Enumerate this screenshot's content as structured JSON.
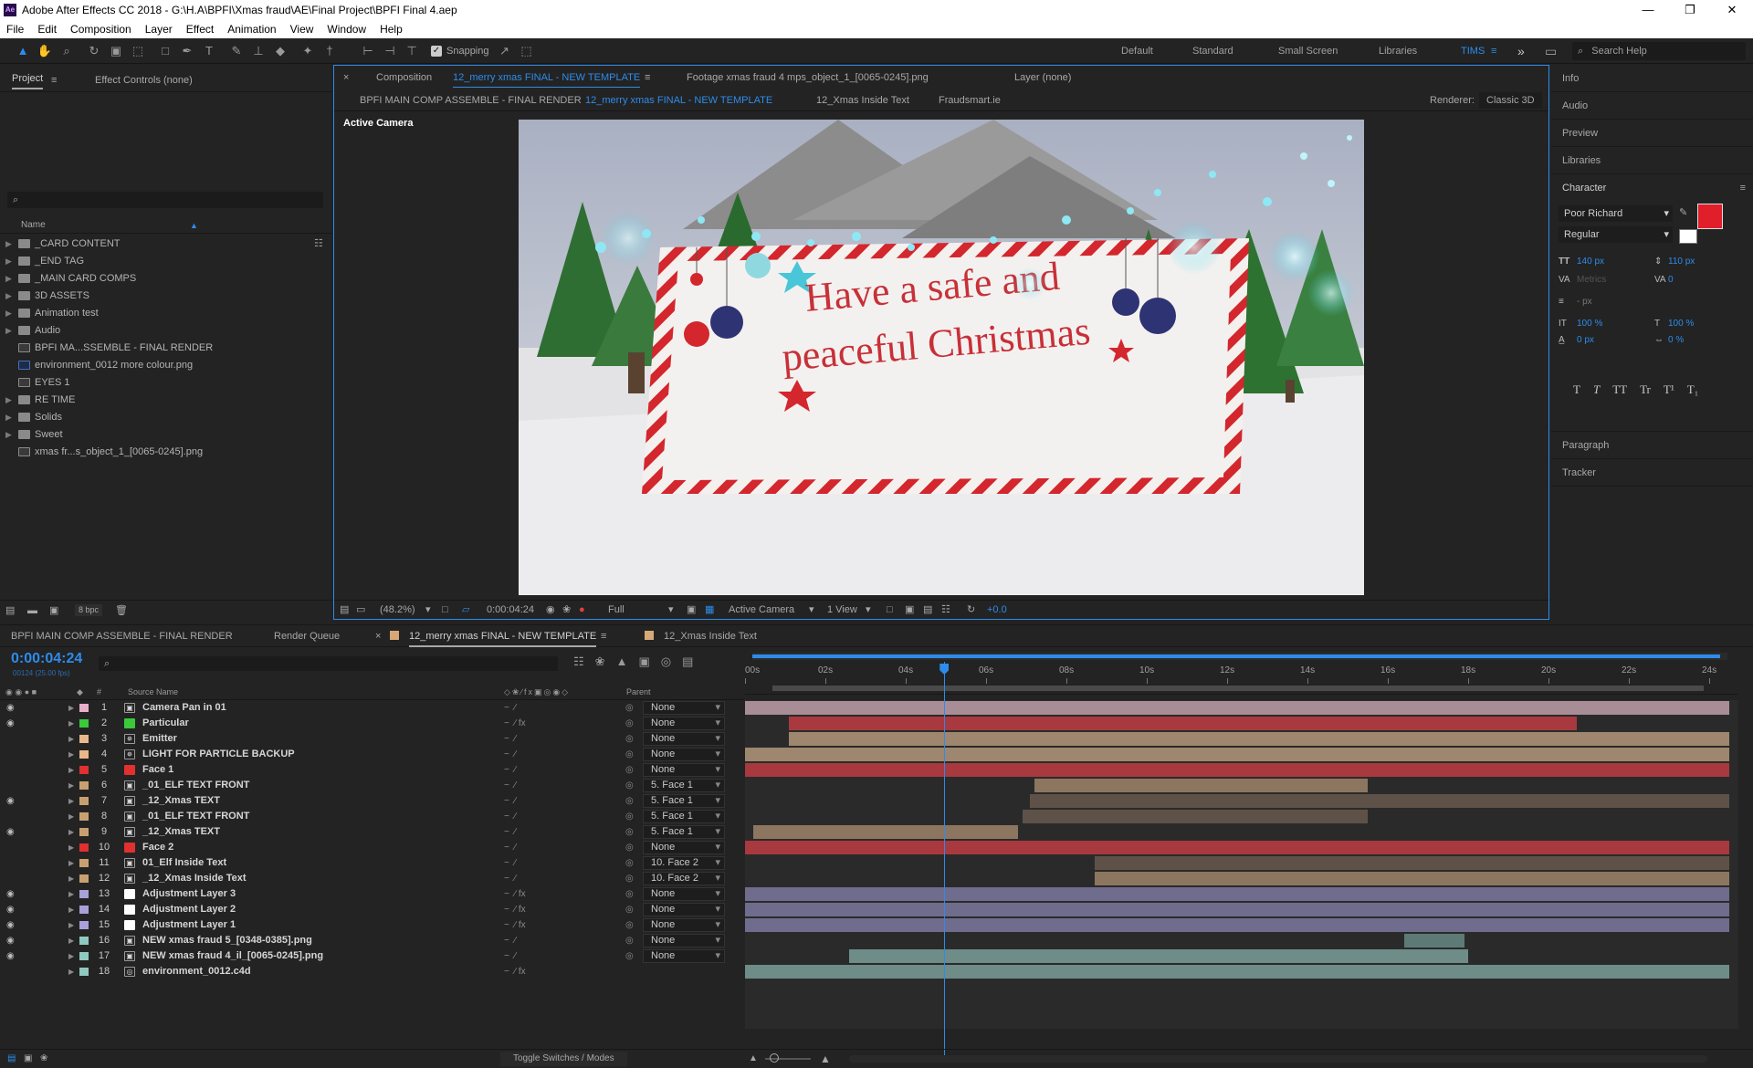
{
  "app": {
    "title": "Adobe After Effects CC 2018 - G:\\H.A\\BPFI\\Xmas fraud\\AE\\Final Project\\BPFI Final 4.aep",
    "logo": "Ae",
    "win": {
      "min": "—",
      "max": "❐",
      "close": "✕"
    }
  },
  "menu": [
    "File",
    "Edit",
    "Composition",
    "Layer",
    "Effect",
    "Animation",
    "View",
    "Window",
    "Help"
  ],
  "toolbar": {
    "snapping": "Snapping",
    "workspaces": [
      "Default",
      "Standard",
      "Small Screen",
      "Libraries",
      "TIMS"
    ],
    "active_workspace": "TIMS",
    "more": "»",
    "search": "Search Help"
  },
  "project": {
    "tab": "Project",
    "menu": "≡",
    "effects_tab": "Effect Controls (none)",
    "search_placeholder": "",
    "col_name": "Name",
    "bpc": "8 bpc",
    "items": [
      {
        "name": "_CARD CONTENT",
        "type": "folder"
      },
      {
        "name": "_END TAG",
        "type": "folder"
      },
      {
        "name": "_MAIN CARD COMPS",
        "type": "folder"
      },
      {
        "name": "3D ASSETS",
        "type": "folder"
      },
      {
        "name": "Animation test",
        "type": "folder"
      },
      {
        "name": "Audio",
        "type": "folder"
      },
      {
        "name": "BPFI MA...SSEMBLE - FINAL RENDER",
        "type": "comp"
      },
      {
        "name": "environment_0012 more colour.png",
        "type": "ps"
      },
      {
        "name": "EYES 1",
        "type": "comp"
      },
      {
        "name": "RE TIME",
        "type": "folder"
      },
      {
        "name": "Solids",
        "type": "folder"
      },
      {
        "name": "Sweet",
        "type": "folder"
      },
      {
        "name": "xmas fr...s_object_1_[0065-0245].png",
        "type": "footage"
      }
    ]
  },
  "viewer": {
    "comp_tab_prefix": "Composition",
    "comp_tab_name": "12_merry xmas FINAL - NEW TEMPLATE",
    "menu": "≡",
    "footage_tab": "Footage xmas fraud 4 mps_object_1_[0065-0245].png",
    "layer_tab": "Layer (none)",
    "breadcrumbs": [
      "BPFI MAIN COMP ASSEMBLE - FINAL RENDER",
      "12_merry xmas FINAL - NEW TEMPLATE",
      "12_Xmas Inside Text",
      "Fraudsmart.ie"
    ],
    "renderer_label": "Renderer:",
    "renderer": "Classic 3D",
    "active_camera": "Active Camera",
    "card_line1": "Have a safe and",
    "card_line2": "peaceful Christmas",
    "footer": {
      "zoom": "(48.2%)",
      "time": "0:00:04:24",
      "resolution": "Full",
      "camera": "Active Camera",
      "views": "1 View",
      "exposure": "+0.0"
    }
  },
  "right": {
    "items": [
      "Info",
      "Audio",
      "Preview",
      "Libraries"
    ],
    "character": "Character",
    "menu": "≡",
    "font": "Poor Richard",
    "style": "Regular",
    "size": "140 px",
    "leading": "110 px",
    "kerning": "Metrics",
    "tracking": "0",
    "stroke": "- px",
    "vscale": "100 %",
    "hscale": "100 %",
    "baseline": "0 px",
    "tsume": "0 %",
    "style_buttons": [
      "T",
      "T",
      "TT",
      "Tr",
      "T¹",
      "T₁"
    ],
    "items2": [
      "Paragraph",
      "Tracker"
    ],
    "fill_color": "#e01f2b"
  },
  "timeline": {
    "tabs": [
      "BPFI MAIN COMP ASSEMBLE - FINAL RENDER",
      "Render Queue",
      "12_merry xmas FINAL - NEW TEMPLATE",
      "12_Xmas Inside Text"
    ],
    "close": "×",
    "menu": "≡",
    "timecode": "0:00:04:24",
    "frames": "00124 (25.00 fps)",
    "col_source": "Source Name",
    "col_parent": "Parent",
    "col_hash": "#",
    "toggle": "Toggle Switches / Modes",
    "ticks": [
      "00s",
      "02s",
      "04s",
      "06s",
      "08s",
      "10s",
      "12s",
      "14s",
      "16s",
      "18s",
      "20s",
      "22s",
      "24s"
    ],
    "playhead_sec": 4.96,
    "duration_sec": 24.5,
    "layers": [
      {
        "n": "1",
        "name": "Camera Pan in 01",
        "label": "#e6b0c8",
        "icon": "camera",
        "eye": true,
        "parent": "None",
        "bar": [
          0,
          24.5
        ],
        "bar_color": "#a88d97",
        "fx": false
      },
      {
        "n": "2",
        "name": "Particular",
        "label": "#3ac93a",
        "icon": "solid",
        "eye": true,
        "parent": "None",
        "bar": [
          1.1,
          20.7
        ],
        "bar_color": "#a8393e",
        "fx": true
      },
      {
        "n": "3",
        "name": "Emitter",
        "label": "#e8b88a",
        "icon": "light",
        "eye": false,
        "parent": "None",
        "bar": [
          1.1,
          24.5
        ],
        "bar_color": "#9e876e",
        "fx": false
      },
      {
        "n": "4",
        "name": "LIGHT FOR PARTICLE BACKUP",
        "label": "#e8b88a",
        "icon": "light",
        "eye": false,
        "parent": "None",
        "bar": [
          0,
          24.5
        ],
        "bar_color": "#9e876e",
        "fx": false
      },
      {
        "n": "5",
        "name": "Face 1",
        "label": "#e03030",
        "icon": "solid",
        "eye": false,
        "parent": "None",
        "bar": [
          0,
          24.5
        ],
        "bar_color": "#a8393e",
        "fx": false
      },
      {
        "n": "6",
        "name": "_01_ELF TEXT FRONT",
        "label": "#c8a070",
        "icon": "comp",
        "eye": false,
        "parent": "5. Face 1",
        "bar": [
          7.2,
          15.5
        ],
        "bar_color": "#8c7660",
        "fx": false
      },
      {
        "n": "7",
        "name": "_12_Xmas TEXT",
        "label": "#c8a070",
        "icon": "comp",
        "eye": true,
        "parent": "5. Face 1",
        "bar": [
          7.1,
          24.5
        ],
        "bar_color": "#5e5248",
        "fx": false
      },
      {
        "n": "8",
        "name": "_01_ELF TEXT FRONT",
        "label": "#c8a070",
        "icon": "comp",
        "eye": false,
        "parent": "5. Face 1",
        "bar": [
          6.9,
          15.5
        ],
        "bar_color": "#5e5248",
        "fx": false
      },
      {
        "n": "9",
        "name": "_12_Xmas TEXT",
        "label": "#c8a070",
        "icon": "comp",
        "eye": true,
        "parent": "5. Face 1",
        "bar": [
          0.2,
          6.8
        ],
        "bar_color": "#8c7660",
        "fx": false
      },
      {
        "n": "10",
        "name": "Face 2",
        "label": "#e03030",
        "icon": "solid",
        "eye": false,
        "parent": "None",
        "bar": [
          0,
          24.5
        ],
        "bar_color": "#a8393e",
        "fx": false
      },
      {
        "n": "11",
        "name": "01_Elf Inside Text",
        "label": "#c8a070",
        "icon": "comp",
        "eye": false,
        "parent": "10. Face 2",
        "bar": [
          8.7,
          24.5
        ],
        "bar_color": "#5e5248",
        "fx": false
      },
      {
        "n": "12",
        "name": "_12_Xmas Inside Text",
        "label": "#c8a070",
        "icon": "comp",
        "eye": false,
        "parent": "10. Face 2",
        "bar": [
          8.7,
          24.5
        ],
        "bar_color": "#8c7660",
        "fx": false
      },
      {
        "n": "13",
        "name": "Adjustment Layer 3",
        "label": "#a8a0d8",
        "icon": "white",
        "eye": true,
        "parent": "None",
        "bar": [
          0,
          24.5
        ],
        "bar_color": "#706c8e",
        "fx": true
      },
      {
        "n": "14",
        "name": "Adjustment Layer 2",
        "label": "#a8a0d8",
        "icon": "white",
        "eye": true,
        "parent": "None",
        "bar": [
          0,
          24.5
        ],
        "bar_color": "#706c8e",
        "fx": true
      },
      {
        "n": "15",
        "name": "Adjustment Layer 1",
        "label": "#a8a0d8",
        "icon": "white",
        "eye": true,
        "parent": "None",
        "bar": [
          0,
          24.5
        ],
        "bar_color": "#706c8e",
        "fx": true
      },
      {
        "n": "16",
        "name": "NEW xmas fraud 5_[0348-0385].png",
        "label": "#90c8c0",
        "icon": "comp",
        "eye": true,
        "parent": "None",
        "bar": [
          16.4,
          17.9
        ],
        "bar_color": "#5e7a76",
        "fx": false
      },
      {
        "n": "17",
        "name": "NEW xmas fraud 4_il_[0065-0245].png",
        "label": "#90c8c0",
        "icon": "comp",
        "eye": true,
        "parent": "None",
        "bar": [
          2.6,
          18.0
        ],
        "bar_color": "#6e8c88",
        "fx": false
      },
      {
        "n": "18",
        "name": "environment_0012.c4d",
        "label": "#90c8c0",
        "icon": "c4d",
        "eye": false,
        "parent": "",
        "bar": [
          0,
          24.5
        ],
        "bar_color": "#6e8c88",
        "fx": true
      }
    ]
  }
}
